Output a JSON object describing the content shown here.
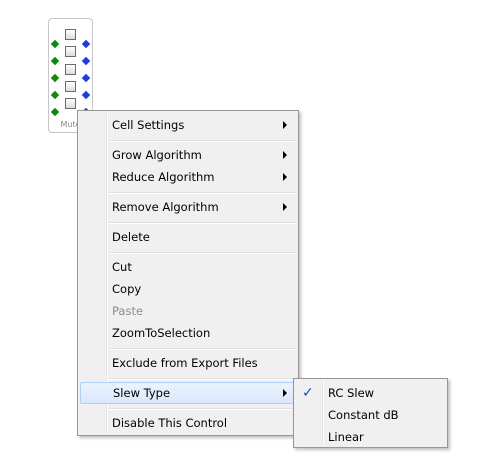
{
  "control": {
    "label": "Mute",
    "rows": 5
  },
  "context_menu": {
    "items": [
      {
        "label": "Cell Settings",
        "submenu": true
      },
      {
        "label": "Grow Algorithm",
        "submenu": true
      },
      {
        "label": "Reduce Algorithm",
        "submenu": true
      },
      {
        "label": "Remove Algorithm",
        "submenu": true
      },
      {
        "label": "Delete"
      },
      {
        "label": "Cut"
      },
      {
        "label": "Copy"
      },
      {
        "label": "Paste",
        "disabled": true
      },
      {
        "label": "ZoomToSelection"
      },
      {
        "label": "Exclude from Export Files"
      },
      {
        "label": "Slew Type",
        "submenu": true,
        "highlighted": true
      },
      {
        "label": "Disable This Control"
      }
    ]
  },
  "slew_submenu": {
    "items": [
      {
        "label": "RC Slew",
        "checked": true
      },
      {
        "label": "Constant dB"
      },
      {
        "label": "Linear"
      }
    ]
  },
  "colors": {
    "highlight": "#d9e8fa",
    "green_node": "#0f8a0f",
    "blue_node": "#1b3ee0",
    "check": "#1a4fb5"
  }
}
